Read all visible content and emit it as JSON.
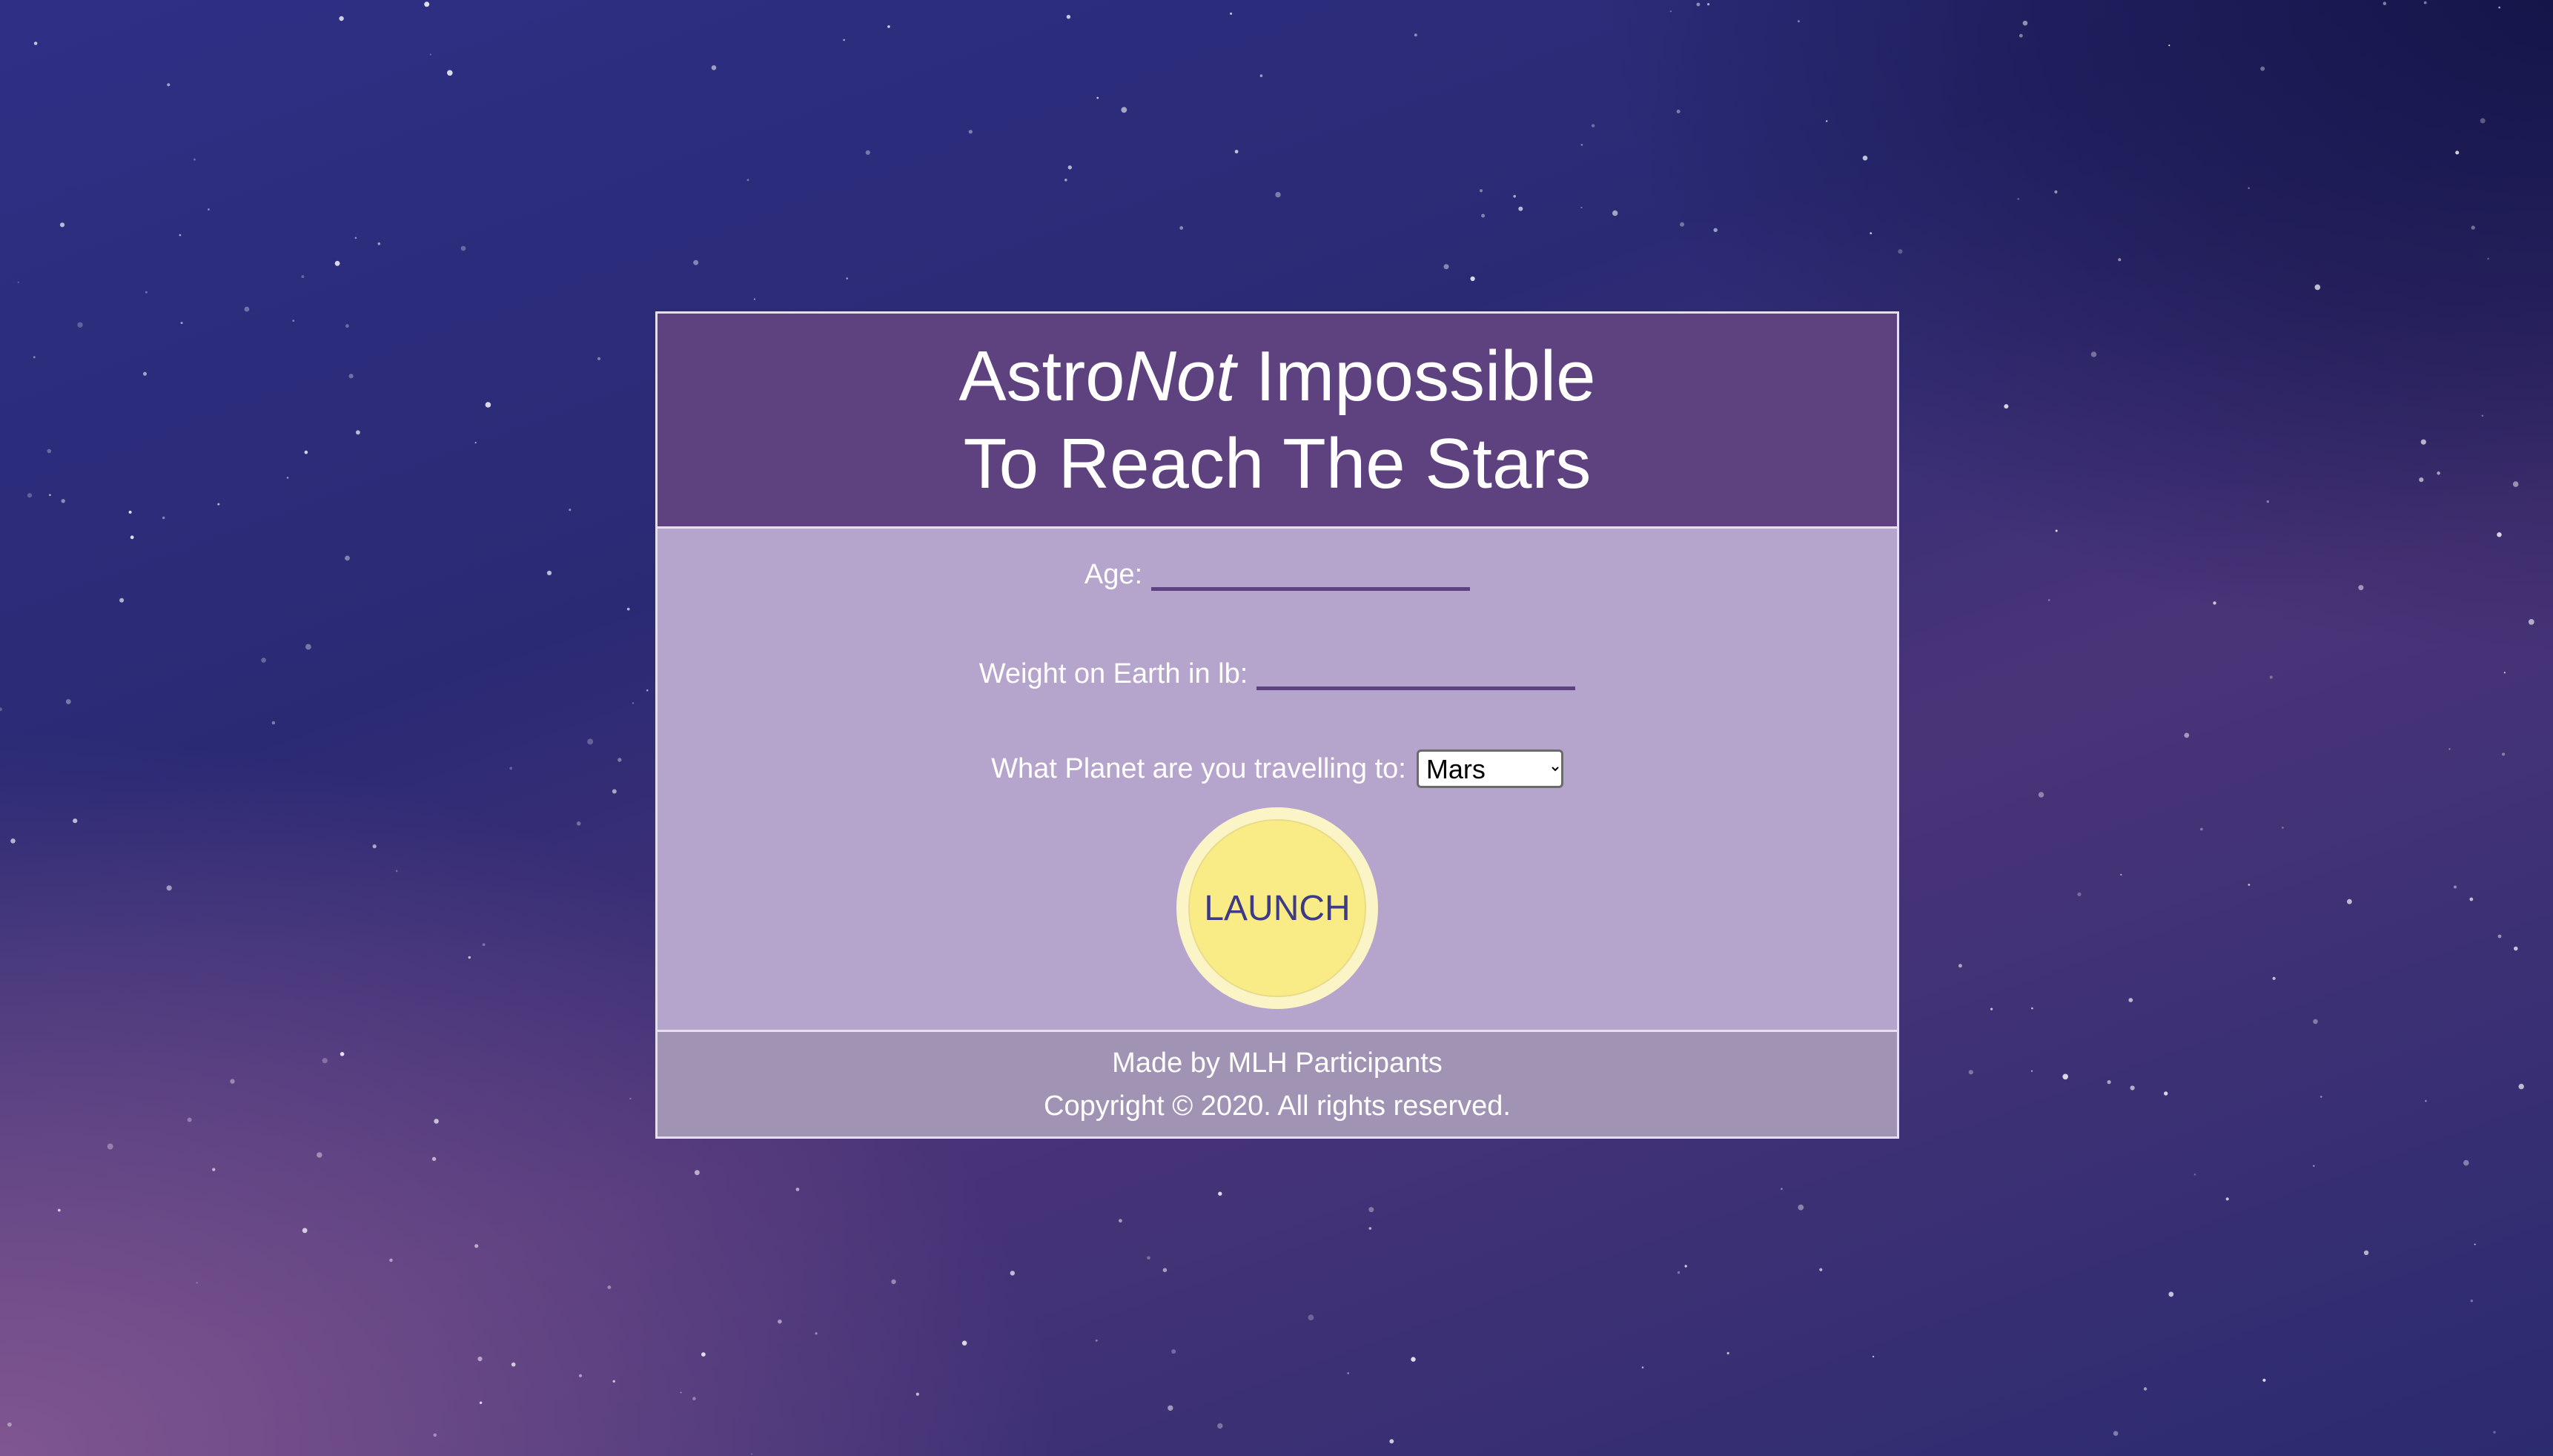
{
  "header": {
    "title_prefix": "Astro",
    "title_emphasis": "Not",
    "title_suffix": " Impossible",
    "subtitle": "To Reach The Stars"
  },
  "form": {
    "age_label": "Age:",
    "age_value": "",
    "weight_label": "Weight on Earth in lb:",
    "weight_value": "",
    "planet_label": "What Planet are you travelling to:",
    "planet_selected": "Mars",
    "launch_label": "LAUNCH"
  },
  "footer": {
    "credit": "Made by MLH Participants",
    "copyright": "Copyright © 2020. All rights reserved."
  },
  "colors": {
    "header_bg": "#5e417f",
    "body_bg": "#b5a4cb",
    "footer_bg": "#a193b3",
    "input_underline": "#5e417f",
    "launch_button": "#f9ec86",
    "launch_text": "#3d3a86"
  }
}
